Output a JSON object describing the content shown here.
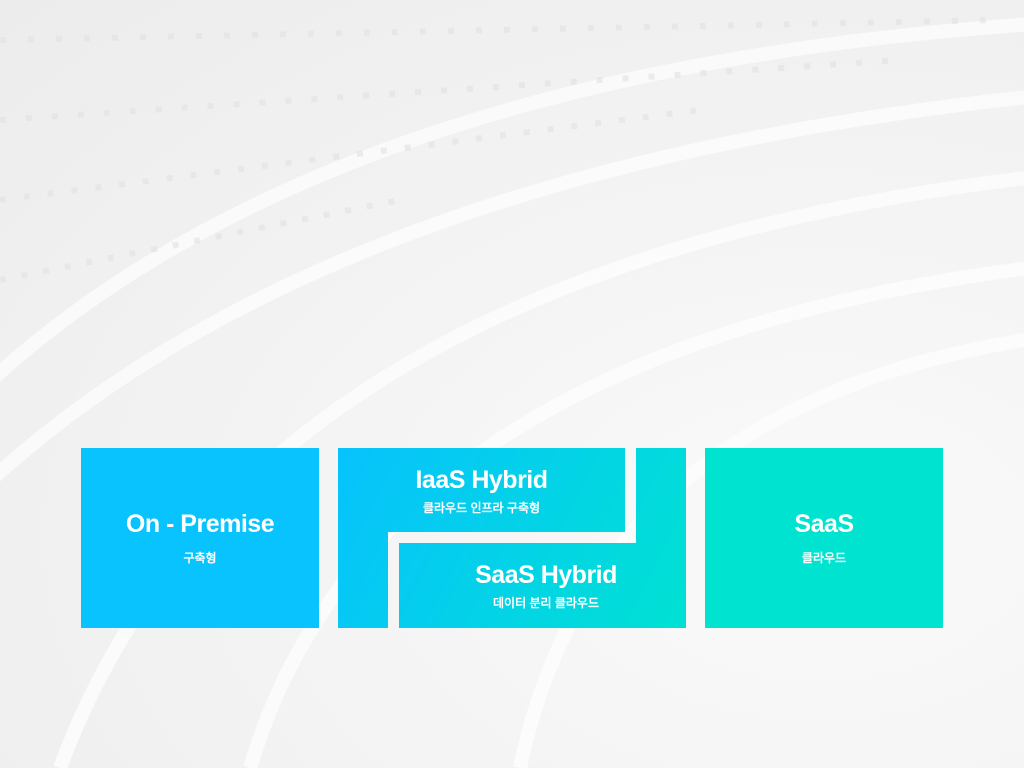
{
  "cards": [
    {
      "title": "On - Premise",
      "subtitle": "구축형"
    },
    {
      "title": "IaaS Hybrid",
      "subtitle": "클라우드 인프라 구축형"
    },
    {
      "title": "SaaS Hybrid",
      "subtitle": "데이터 분리 클라우드"
    },
    {
      "title": "SaaS",
      "subtitle": "클라우드"
    }
  ],
  "colors": {
    "blue": "#08c3fd",
    "teal": "#00e3d0"
  }
}
